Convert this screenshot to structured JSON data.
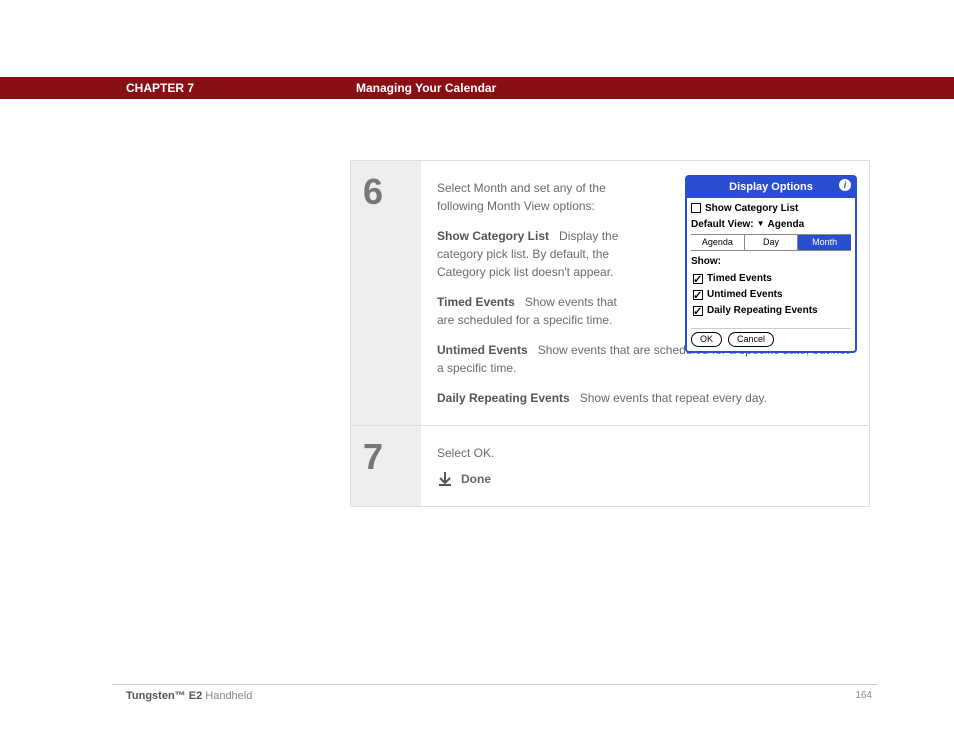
{
  "header": {
    "chapter": "CHAPTER 7",
    "title": "Managing Your Calendar"
  },
  "steps": [
    {
      "number": "6",
      "intro": "Select Month and set any of the following Month View options:",
      "items": [
        {
          "label": "Show Category List",
          "text": "Display the category pick list. By default, the Category pick list doesn't appear."
        },
        {
          "label": "Timed Events",
          "text": "Show events that are scheduled for a specific time."
        },
        {
          "label": "Untimed Events",
          "text": "Show events that are scheduled for a specific date, but not a specific time."
        },
        {
          "label": "Daily Repeating Events",
          "text": "Show events that repeat every day."
        }
      ]
    },
    {
      "number": "7",
      "intro": "Select OK.",
      "done": "Done"
    }
  ],
  "dialog": {
    "title": "Display Options",
    "showCategoryList": "Show Category List",
    "defaultViewLabel": "Default View:",
    "defaultViewValue": "Agenda",
    "tabs": [
      "Agenda",
      "Day",
      "Month"
    ],
    "selectedTab": "Month",
    "showLabel": "Show:",
    "options": [
      "Timed Events",
      "Untimed Events",
      "Daily Repeating Events"
    ],
    "ok": "OK",
    "cancel": "Cancel"
  },
  "footer": {
    "product_bold": "Tungsten™ E2",
    "product_rest": " Handheld",
    "page": "164"
  }
}
